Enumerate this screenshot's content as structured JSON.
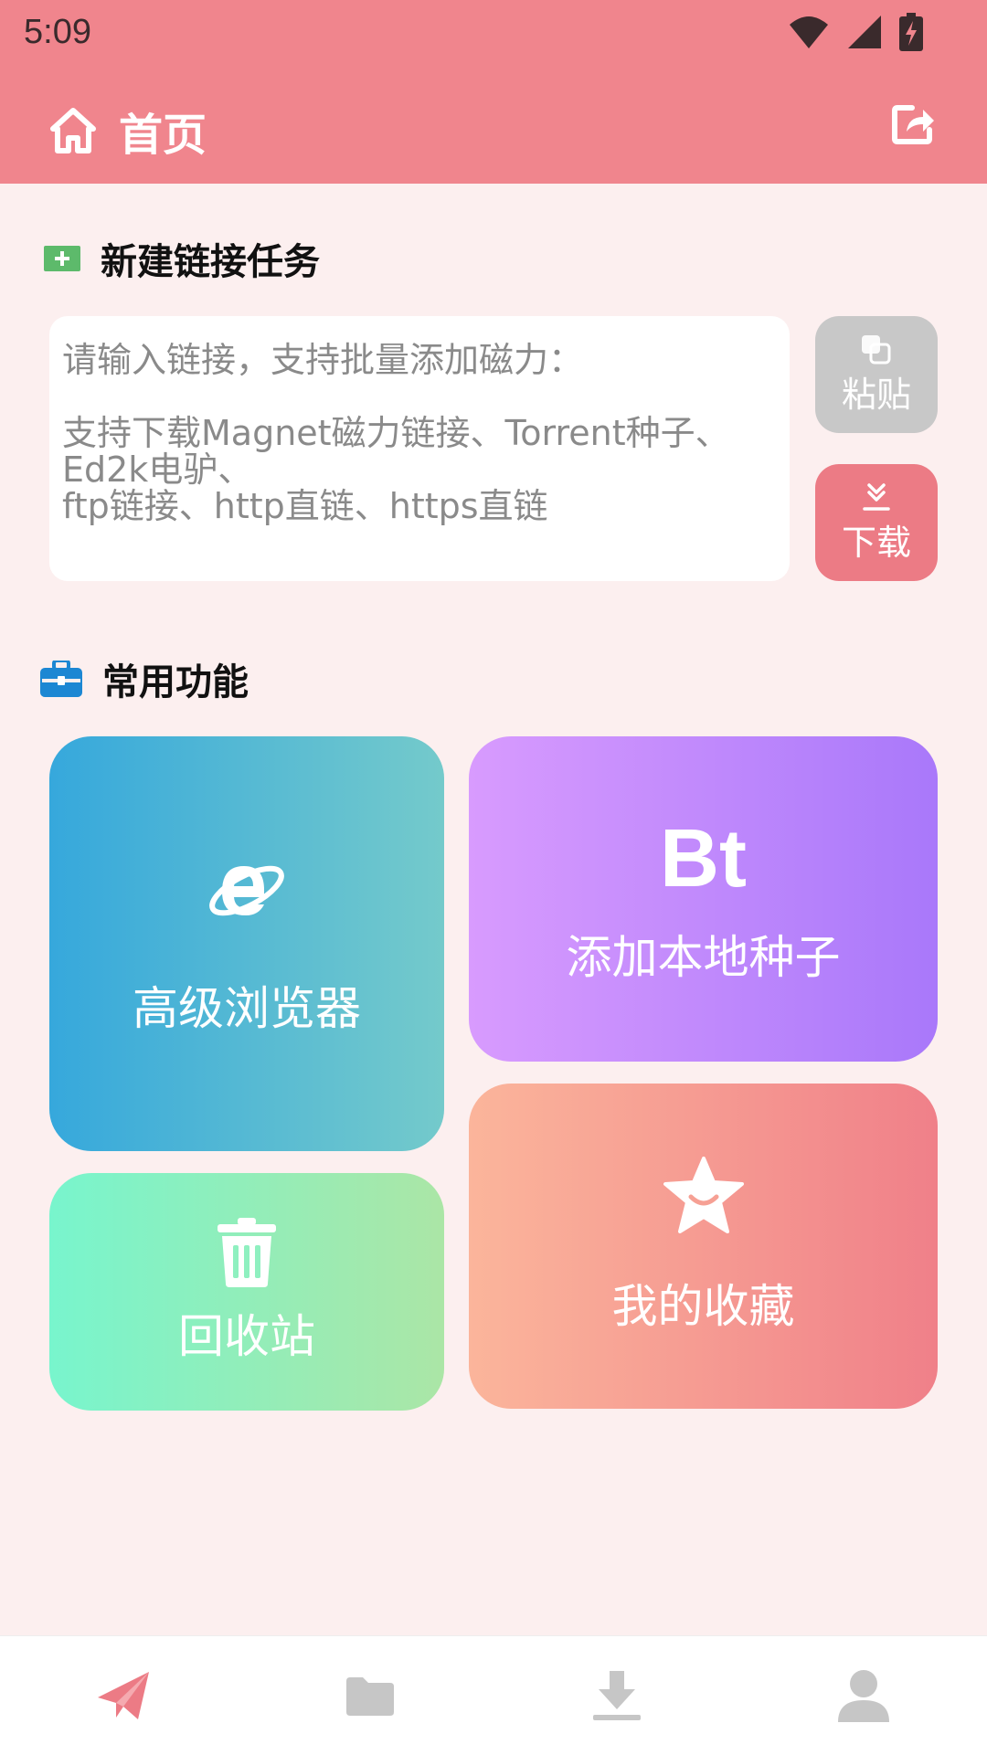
{
  "status": {
    "time": "5:09"
  },
  "header": {
    "title": "首页"
  },
  "new_task": {
    "title": "新建链接任务",
    "placeholder": "请输入链接，支持批量添加磁力：\n\n支持下载Magnet磁力链接、Torrent种子、Ed2k电驴、\nftp链接、http直链、https直链",
    "paste_label": "粘贴",
    "download_label": "下载"
  },
  "features": {
    "title": "常用功能",
    "browser_label": "高级浏览器",
    "bt_badge": "Bt",
    "bt_label": "添加本地种子",
    "trash_label": "回收站",
    "favorites_label": "我的收藏"
  },
  "colors": {
    "header": "#f0858d",
    "background": "#fcefef",
    "accent": "#ec7b85"
  },
  "nav_icons": [
    "paper-plane-icon",
    "folder-icon",
    "download-icon",
    "person-icon"
  ]
}
